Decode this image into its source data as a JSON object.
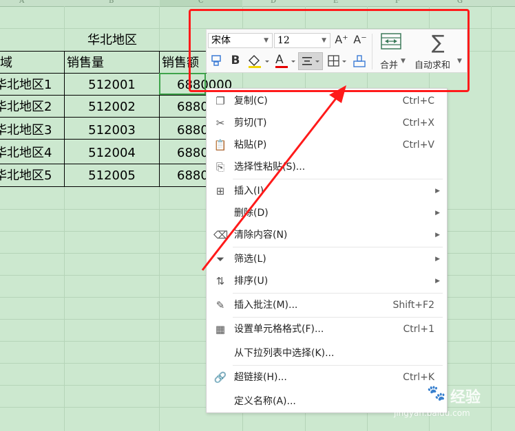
{
  "column_headers": [
    "A",
    "B",
    "C",
    "D",
    "E",
    "F",
    "G"
  ],
  "sheet": {
    "title": "华北地区",
    "headers": [
      "域",
      "销售量",
      "销售额"
    ],
    "rows": [
      {
        "region": "华北地区1",
        "qty": "512001",
        "amount": "6880000"
      },
      {
        "region": "华北地区2",
        "qty": "512002",
        "amount": "6880"
      },
      {
        "region": "华北地区3",
        "qty": "512003",
        "amount": "6880"
      },
      {
        "region": "华北地区4",
        "qty": "512004",
        "amount": "6880"
      },
      {
        "region": "华北地区5",
        "qty": "512005",
        "amount": "6880"
      }
    ]
  },
  "mini_toolbar": {
    "font_name": "宋体",
    "font_size": "12",
    "grow_font": "A⁺",
    "shrink_font": "A⁻",
    "bold": "B",
    "font_color_letter": "A",
    "merge_label": "合并",
    "autosum_label": "自动求和"
  },
  "context_menu": {
    "items": [
      {
        "icon": "copy-icon",
        "label": "复制(C)",
        "shortcut": "Ctrl+C"
      },
      {
        "icon": "cut-icon",
        "label": "剪切(T)",
        "shortcut": "Ctrl+X"
      },
      {
        "icon": "paste-icon",
        "label": "粘贴(P)",
        "shortcut": "Ctrl+V"
      },
      {
        "icon": "paste-special-icon",
        "label": "选择性粘贴(S)...",
        "shortcut": ""
      },
      {
        "icon": "insert-icon",
        "label": "插入(I)",
        "shortcut": ""
      },
      {
        "icon": "",
        "label": "删除(D)",
        "shortcut": ""
      },
      {
        "icon": "eraser-icon",
        "label": "清除内容(N)",
        "shortcut": ""
      },
      {
        "icon": "filter-icon",
        "label": "筛选(L)",
        "shortcut": ""
      },
      {
        "icon": "sort-icon",
        "label": "排序(U)",
        "shortcut": ""
      },
      {
        "icon": "comment-icon",
        "label": "插入批注(M)...",
        "shortcut": "Shift+F2"
      },
      {
        "icon": "format-cells-icon",
        "label": "设置单元格格式(F)...",
        "shortcut": "Ctrl+1"
      },
      {
        "icon": "",
        "label": "从下拉列表中选择(K)...",
        "shortcut": ""
      },
      {
        "icon": "hyperlink-icon",
        "label": "超链接(H)...",
        "shortcut": "Ctrl+K"
      },
      {
        "icon": "",
        "label": "定义名称(A)...",
        "shortcut": ""
      }
    ]
  },
  "watermark": {
    "brand": "Bai",
    "brand_cn": "经验",
    "url": "jingyan.baidu.com"
  },
  "colors": {
    "sheet_bg": "#cce8cf",
    "active_cell": "#3ea34a",
    "highlight": "#ff1a1a"
  }
}
